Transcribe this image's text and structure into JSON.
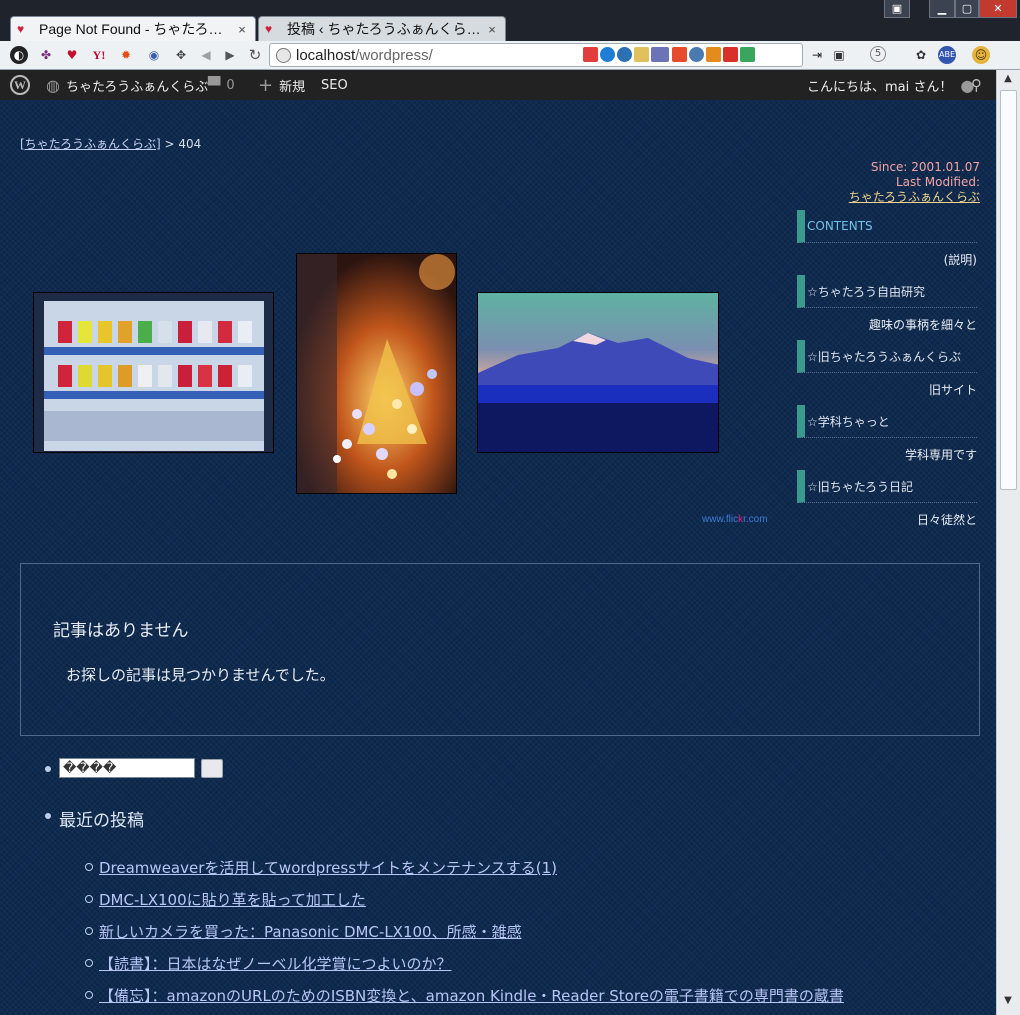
{
  "browser": {
    "tabs": [
      {
        "title": "Page Not Found - ちゃたろ…",
        "close": "×"
      },
      {
        "title": "投稿 ‹ ちゃたろうふぁんくら…",
        "close": "×"
      }
    ],
    "url_host": "localhost",
    "url_path": "/wordpress/"
  },
  "adminbar": {
    "site_name": "ちゃたろうふぁんくらぶ",
    "comments_count": "0",
    "new_label": "新規",
    "seo_label": "SEO",
    "greeting": "こんにちは、mai さん！"
  },
  "breadcrumb": {
    "home": "[ちゃたろうふぁんくらぶ]",
    "separator": " > ",
    "current": "404"
  },
  "since": {
    "since": "Since: 2001.01.07",
    "modified": "Last Modified:",
    "site_link": "ちゃたろうふぁんくらぶ"
  },
  "menu": {
    "heading": "CONTENTS",
    "items": [
      {
        "desc": "(説明)"
      },
      {
        "title": "☆ちゃたろう自由研究",
        "desc": "趣味の事柄を細々と"
      },
      {
        "title": "☆旧ちゃたろうふぁんくらぶ",
        "desc": "旧サイト"
      },
      {
        "title": "☆学科ちゃっと",
        "desc": "学科専用です"
      },
      {
        "title": "☆旧ちゃたろう日記",
        "desc": "日々徒然と"
      }
    ]
  },
  "flickr": {
    "pre": "www.flic",
    "k": "k",
    "post": "r.com"
  },
  "notfound": {
    "title": "記事はありません",
    "message": "お探しの記事は見つかりませんでした。"
  },
  "search": {
    "value": "����"
  },
  "recent": {
    "title": "最近の投稿",
    "posts": [
      "Dreamweaverを活用してwordpressサイトをメンテナンスする(1)",
      "DMC-LX100に貼り革を貼って加工した",
      "新しいカメラを買った：Panasonic DMC-LX100、所感・雑感",
      "【読書】：日本はなぜノーベル化学賞につよいのか？",
      "【備忘】：amazonのURLのためのISBN変換と、amazon Kindle・Reader Storeの電子書籍での専門書の蔵書"
    ]
  },
  "colors": {
    "accent": "#3b9a8f",
    "page_bg": "#0f2a4f",
    "link": "#b8c6f6"
  }
}
